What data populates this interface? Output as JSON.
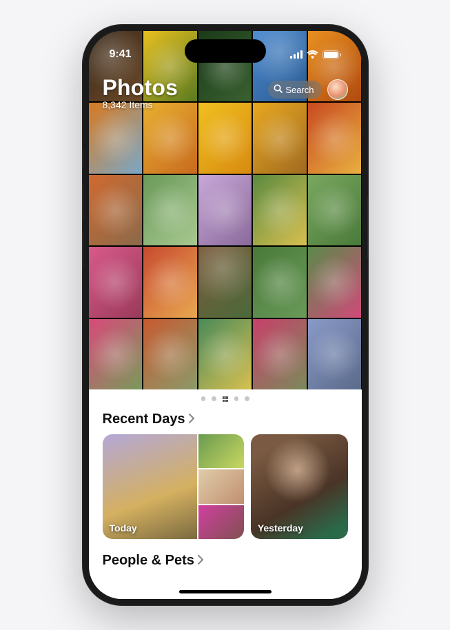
{
  "status": {
    "time": "9:41"
  },
  "header": {
    "title": "Photos",
    "item_count": "8,342 Items",
    "search_label": "Search"
  },
  "grid": {
    "thumbs": [
      {
        "c1": "#3a2818",
        "c2": "#6b4a2a"
      },
      {
        "c1": "#e8c020",
        "c2": "#5a7a20"
      },
      {
        "c1": "#1a3a18",
        "c2": "#3a6030"
      },
      {
        "c1": "#4a8ad0",
        "c2": "#2a5a90"
      },
      {
        "c1": "#e89020",
        "c2": "#b04a10"
      },
      {
        "c1": "#d87a20",
        "c2": "#7aa8c8"
      },
      {
        "c1": "#e8b030",
        "c2": "#c86a20"
      },
      {
        "c1": "#f0c020",
        "c2": "#d88a10"
      },
      {
        "c1": "#e8a820",
        "c2": "#a06a20"
      },
      {
        "c1": "#c84a20",
        "c2": "#e8b040"
      },
      {
        "c1": "#d06a30",
        "c2": "#8a6a4a"
      },
      {
        "c1": "#6a9a5a",
        "c2": "#a8c890"
      },
      {
        "c1": "#c8a8d8",
        "c2": "#8a6a9a"
      },
      {
        "c1": "#5a8a40",
        "c2": "#d8c050"
      },
      {
        "c1": "#7aa860",
        "c2": "#4a7a3a"
      },
      {
        "c1": "#d85a8a",
        "c2": "#9a3a5a"
      },
      {
        "c1": "#c84a30",
        "c2": "#e8a850"
      },
      {
        "c1": "#7a5a3a",
        "c2": "#4a6a3a"
      },
      {
        "c1": "#4a7a3a",
        "c2": "#6a9a5a"
      },
      {
        "c1": "#5a8a4a",
        "c2": "#d04a7a"
      },
      {
        "c1": "#d84a7a",
        "c2": "#7a9a5a"
      },
      {
        "c1": "#c85a30",
        "c2": "#8a9a6a"
      },
      {
        "c1": "#4a8a5a",
        "c2": "#d8c050"
      },
      {
        "c1": "#c8406a",
        "c2": "#7a8a5a"
      },
      {
        "c1": "#8a9ac8",
        "c2": "#5a6a8a"
      }
    ]
  },
  "pager": {
    "count": 5,
    "active_index": 2
  },
  "sections": {
    "recent_days": {
      "title": "Recent Days",
      "cards": [
        {
          "label": "Today"
        },
        {
          "label": "Yesterday"
        }
      ]
    },
    "people_pets": {
      "title": "People & Pets"
    }
  }
}
